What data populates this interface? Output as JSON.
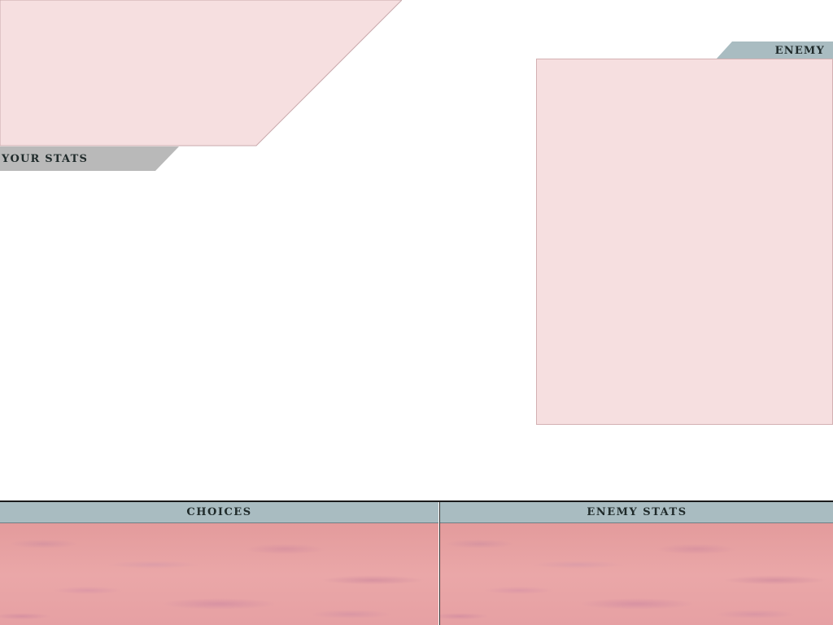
{
  "player": {
    "stats_tab_label": "YOUR STATS"
  },
  "enemy": {
    "tab_label": "ENEMY"
  },
  "bottom": {
    "choices_header": "CHOICES",
    "enemy_stats_header": "ENEMY STATS"
  },
  "colors": {
    "panel_pink": "#f6dfe0",
    "tab_gray": "#b9b9b9",
    "tab_blue_gray": "#a9bcc1",
    "header_text": "#1f2a2a",
    "body_pink": "#e9a3a4"
  }
}
